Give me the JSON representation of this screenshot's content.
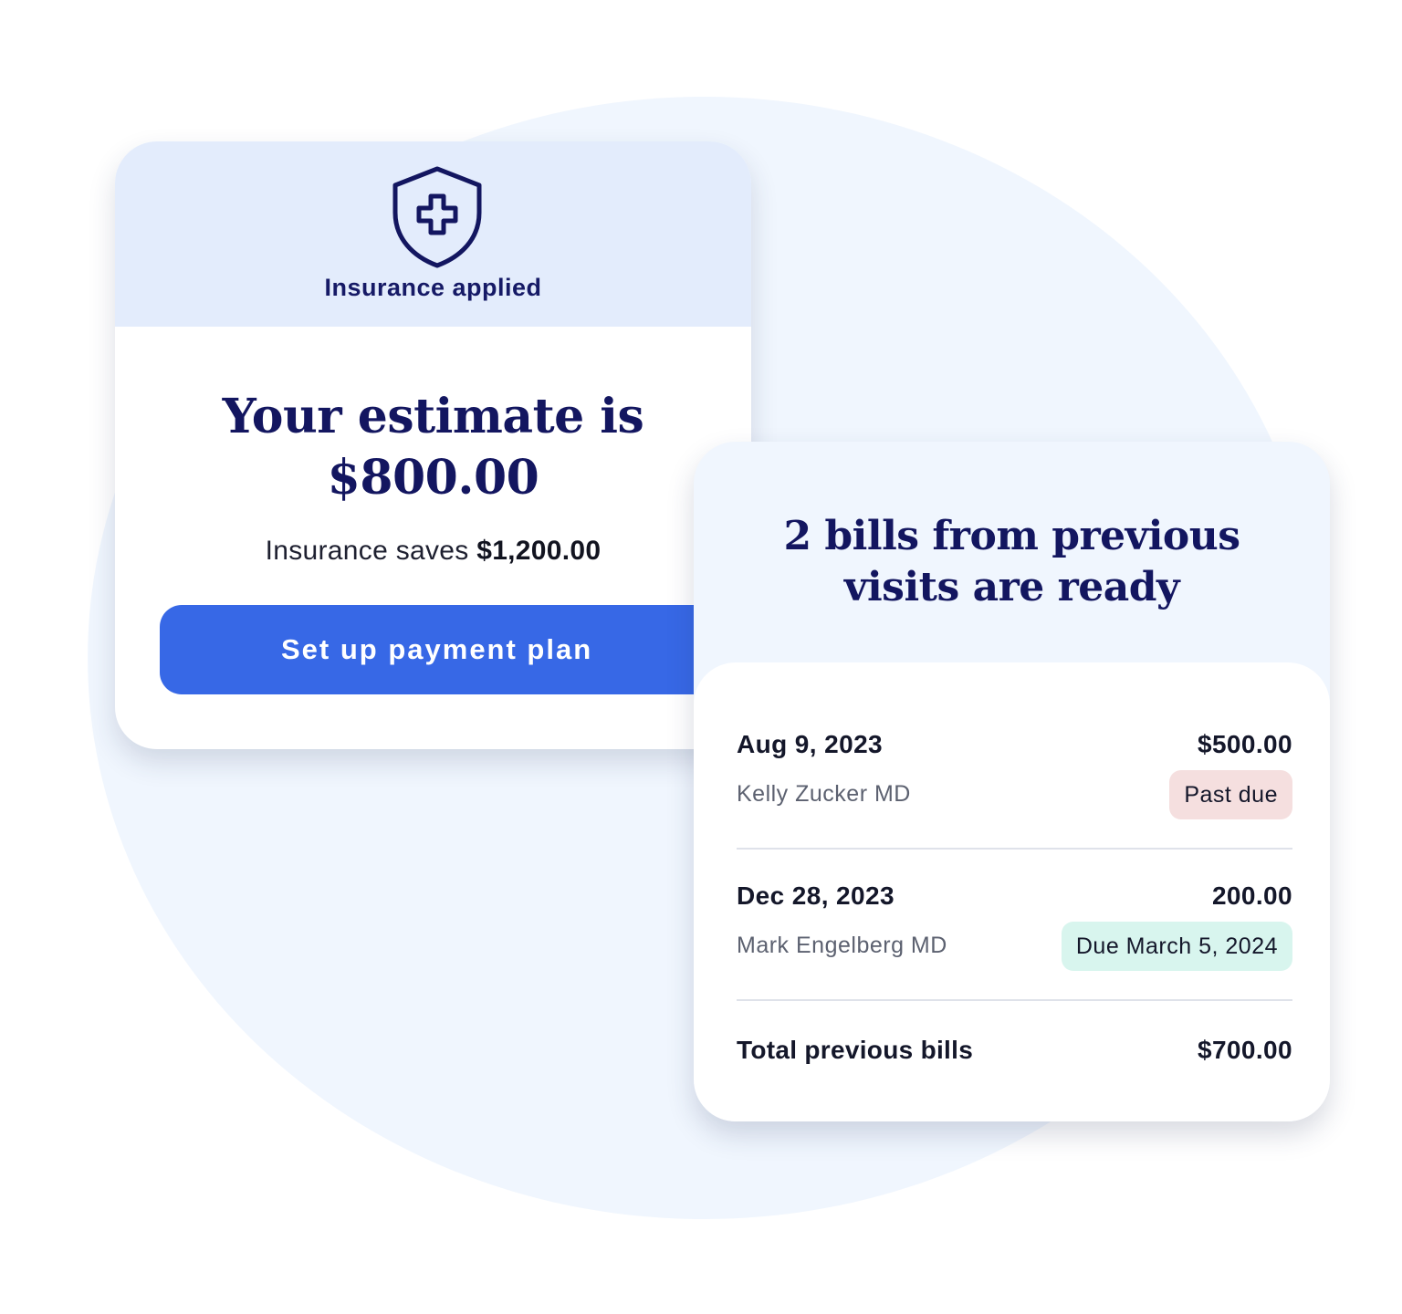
{
  "estimate_card": {
    "header_label": "Insurance applied",
    "title_line1": "Your estimate is",
    "title_line2": "$800.00",
    "savings_prefix": "Insurance saves",
    "savings_amount": "$1,200.00",
    "button_label": "Set up payment plan"
  },
  "bills_card": {
    "title_line1": "2 bills from previous",
    "title_line2": "visits are ready",
    "bills": [
      {
        "date": "Aug 9, 2023",
        "amount": "$500.00",
        "provider": "Kelly Zucker MD",
        "status": "Past due"
      },
      {
        "date": "Dec 28, 2023",
        "amount": "200.00",
        "provider": "Mark Engelberg MD",
        "status": "Due March 5, 2024"
      }
    ],
    "total_label": "Total previous bills",
    "total_amount": "$700.00"
  },
  "icons": {
    "shield": "shield-plus-icon"
  },
  "colors": {
    "navy": "#131660",
    "button": "#3768e6",
    "header_bg": "#e3ecfc",
    "past_due_bg": "#f5dfdf",
    "due_bg": "#d8f5ee"
  }
}
